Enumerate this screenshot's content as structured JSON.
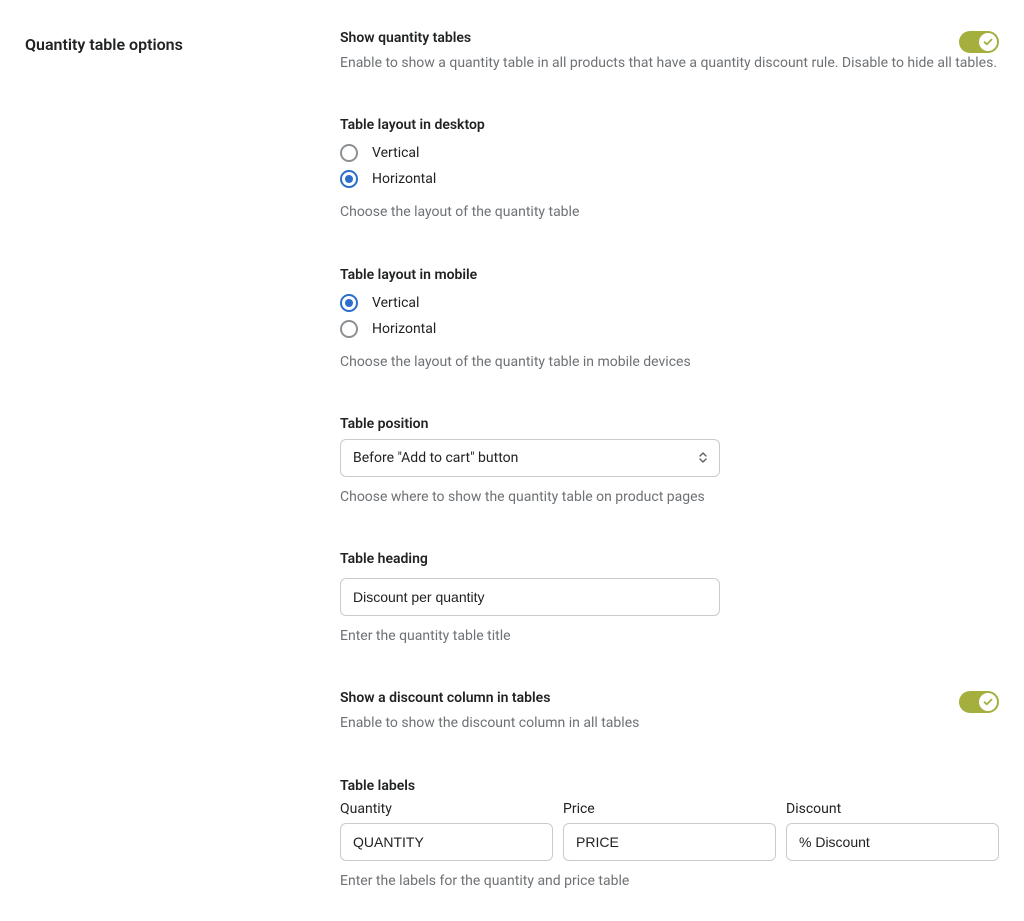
{
  "page": {
    "title": "Quantity table options"
  },
  "show_tables": {
    "title": "Show quantity tables",
    "desc": "Enable to show a quantity table in all products that have a quantity discount rule. Disable to hide all tables.",
    "on": true
  },
  "layout_desktop": {
    "title": "Table layout in desktop",
    "options": {
      "vertical": "Vertical",
      "horizontal": "Horizontal"
    },
    "selected": "horizontal",
    "desc": "Choose the layout of the quantity table"
  },
  "layout_mobile": {
    "title": "Table layout in mobile",
    "options": {
      "vertical": "Vertical",
      "horizontal": "Horizontal"
    },
    "selected": "vertical",
    "desc": "Choose the layout of the quantity table in mobile devices"
  },
  "position": {
    "title": "Table position",
    "value": "Before \"Add to cart\" button",
    "desc": "Choose where to show the quantity table on product pages"
  },
  "heading": {
    "title": "Table heading",
    "value": "Discount per quantity",
    "desc": "Enter the quantity table title"
  },
  "discount_col": {
    "title": "Show a discount column in tables",
    "desc": "Enable to show the discount column in all tables",
    "on": true
  },
  "labels": {
    "title": "Table labels",
    "quantity_label": "Quantity",
    "price_label": "Price",
    "discount_label": "Discount",
    "quantity_value": "QUANTITY",
    "price_value": "PRICE",
    "discount_value": "% Discount",
    "desc": "Enter the labels for the quantity and price table"
  }
}
